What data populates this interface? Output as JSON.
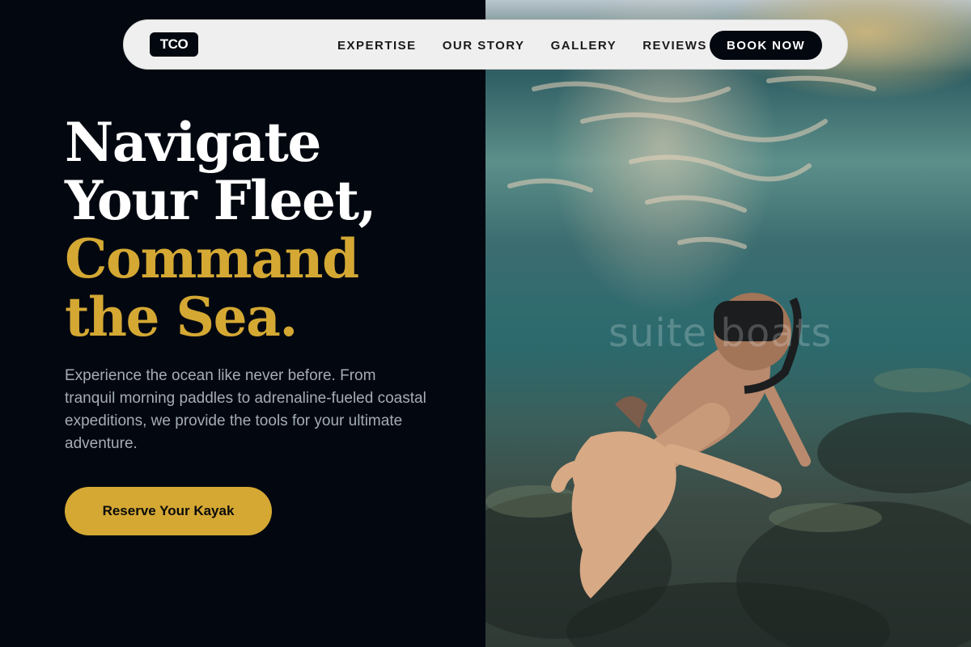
{
  "brand": {
    "logo_text": "TCO"
  },
  "nav": {
    "links": [
      {
        "label": "EXPERTISE"
      },
      {
        "label": "OUR STORY"
      },
      {
        "label": "GALLERY"
      },
      {
        "label": "REVIEWS"
      }
    ],
    "cta_label": "BOOK NOW"
  },
  "hero": {
    "title_line1": "Navigate",
    "title_line2": "Your Fleet,",
    "title_line3": "Command",
    "title_line4": "the Sea.",
    "description": "Experience the ocean like never before. From tranquil morning paddles to adrenaline-fueled coastal expeditions, we provide the tools for your ultimate adventure.",
    "cta_label": "Reserve Your Kayak"
  },
  "image": {
    "watermark": "suite boats"
  },
  "colors": {
    "background": "#030810",
    "accent": "#d4a833",
    "nav_bg": "#efefef",
    "text_muted": "#a4acb6"
  }
}
